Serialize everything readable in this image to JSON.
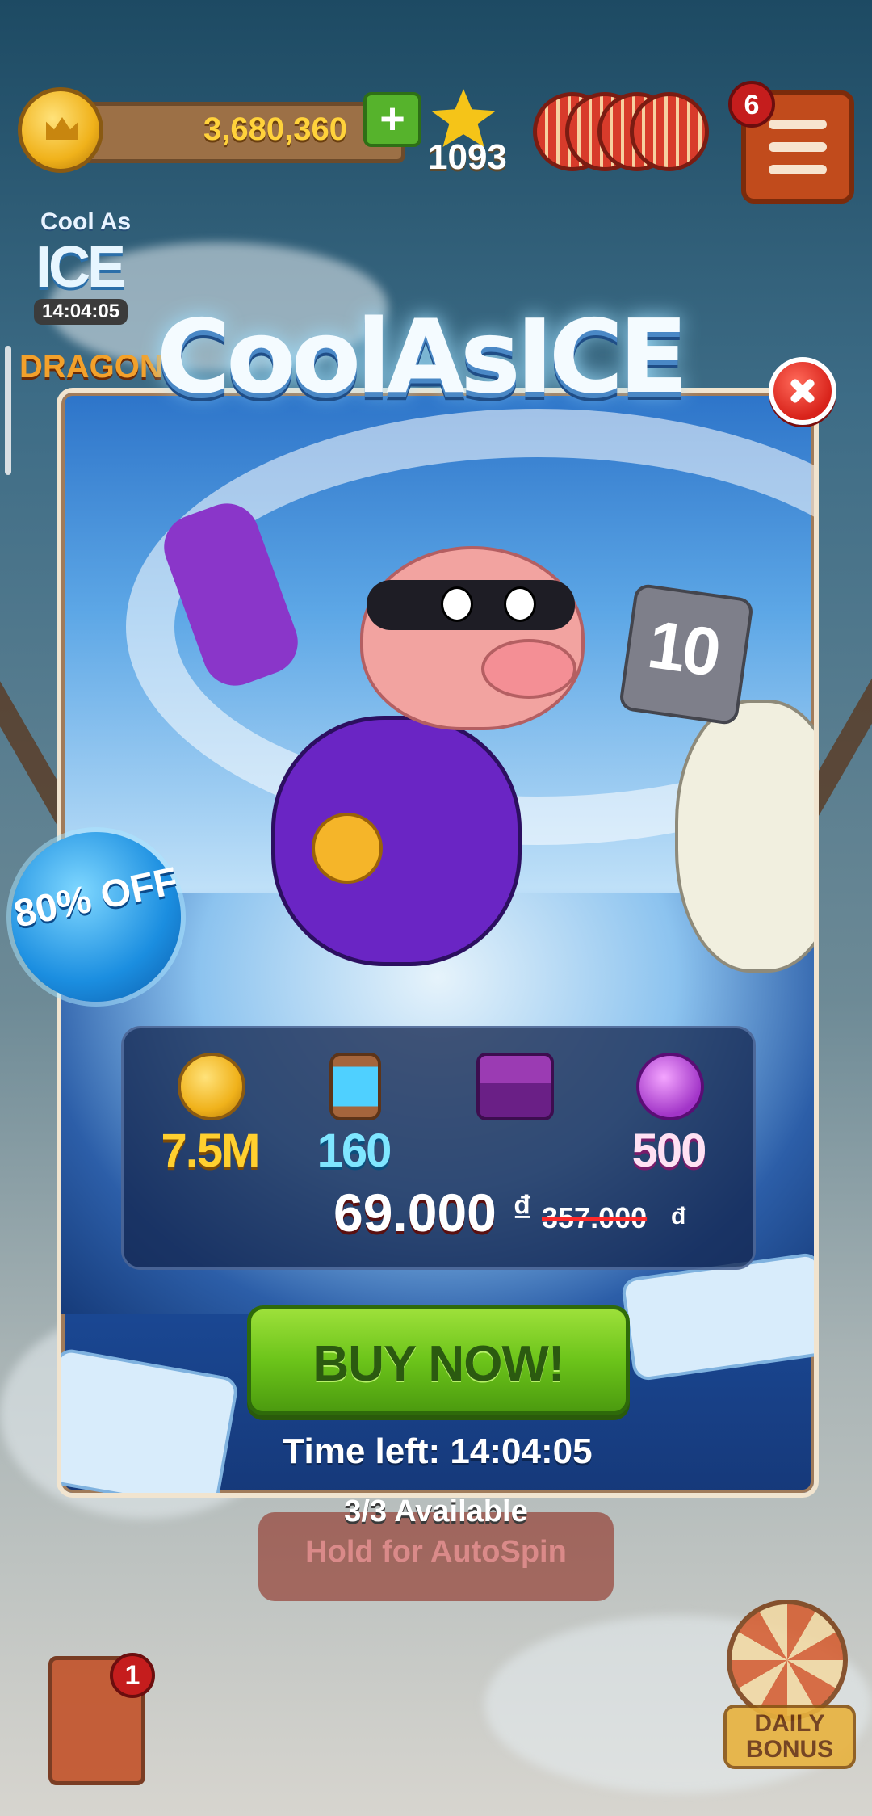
{
  "header": {
    "coins": "3,680,360",
    "plus_label": "+",
    "stars": "1093",
    "menu_badge": "6"
  },
  "side_events": {
    "event1_title_small": "Cool As",
    "event1_title_big": "ICE",
    "event1_timer": "14:04:05",
    "event2_title": "DRAGON"
  },
  "offer": {
    "title": "CoolAsICE",
    "sign_number": "10",
    "discount": "80% OFF",
    "rewards": [
      {
        "label": "7.5M",
        "icon": "coin-icon"
      },
      {
        "label": "160",
        "icon": "battery-icon"
      },
      {
        "label": "",
        "icon": "chest-icon"
      },
      {
        "label": "500",
        "icon": "xp-potion-icon"
      }
    ],
    "price_now": "69.000",
    "currency": "₫",
    "price_old": "357.000",
    "price_old_currency": "đ",
    "buy_label": "BUY NOW!",
    "time_left": "Time left: 14:04:05",
    "availability": "3/3  Available"
  },
  "bottom": {
    "autospin_label": "Hold for AutoSpin",
    "cards_badge": "1",
    "daily_bonus": "DAILY BONUS"
  }
}
